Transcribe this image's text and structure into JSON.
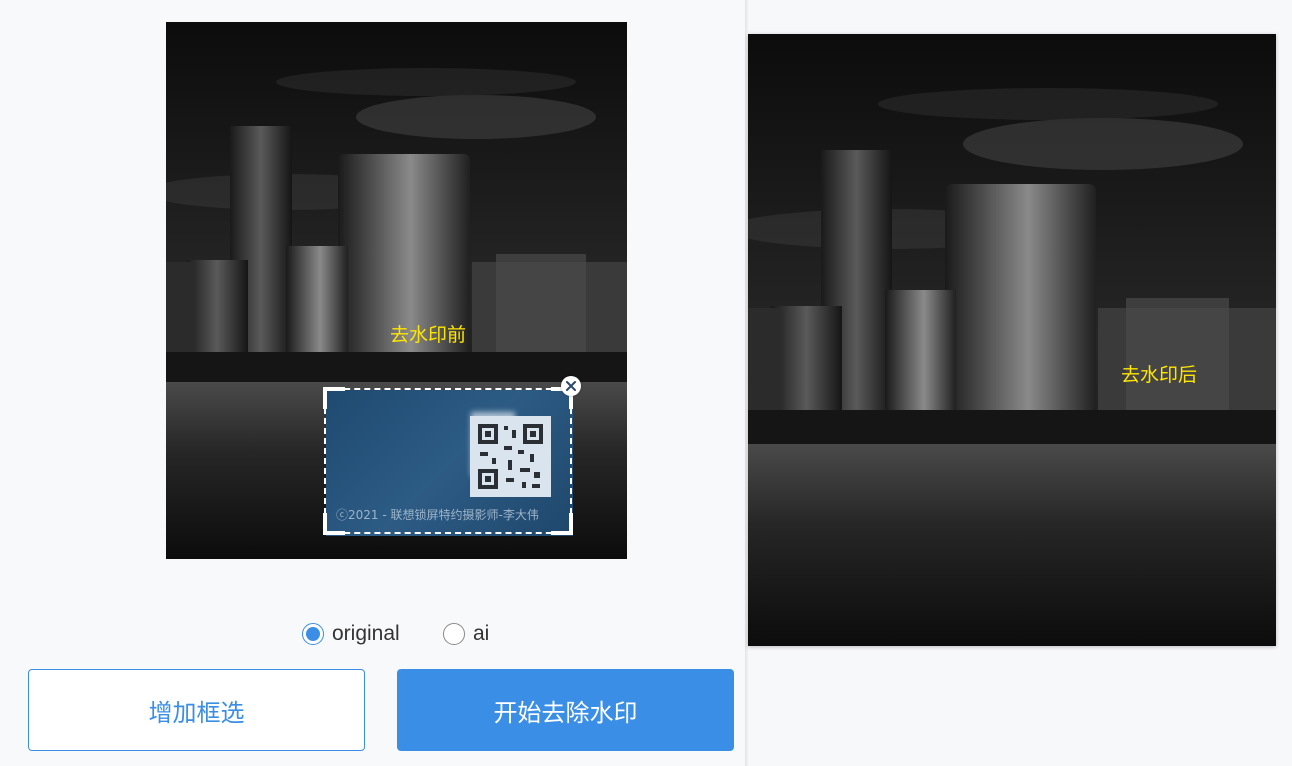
{
  "before": {
    "caption": "去水印前",
    "watermark_text": "ⓒ2021 - 联想锁屏特约摄影师-李大伟"
  },
  "after": {
    "caption": "去水印后"
  },
  "mode": {
    "selected": "original",
    "options": [
      {
        "label": "original",
        "checked": true
      },
      {
        "label": "ai",
        "checked": false
      }
    ]
  },
  "buttons": {
    "add_selection": "增加框选",
    "start_remove": "开始去除水印"
  },
  "colors": {
    "accent": "#3a8ee6",
    "caption": "#ffe600"
  },
  "icons": {
    "close": "close-icon"
  }
}
